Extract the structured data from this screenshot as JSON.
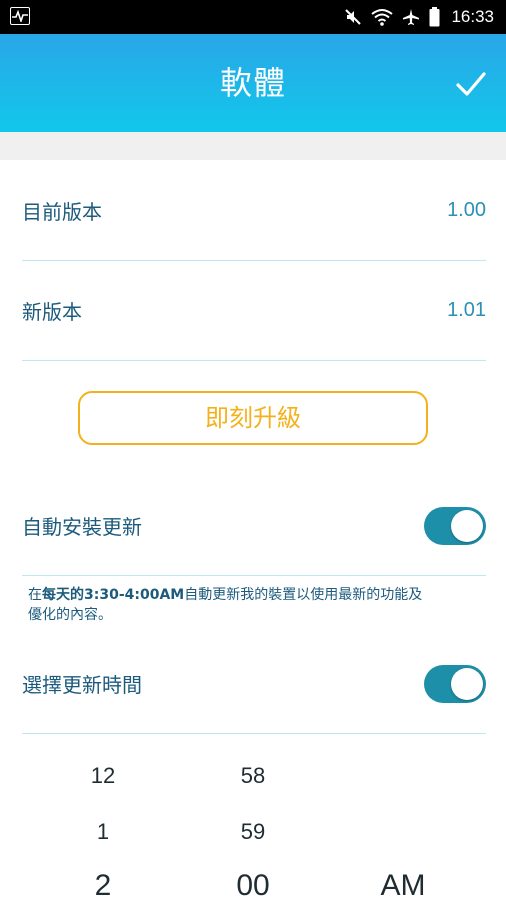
{
  "status_bar": {
    "time": "16:33",
    "icons": [
      "pulse-app-icon",
      "mute-icon",
      "wifi-icon",
      "airplane-icon",
      "battery-icon"
    ]
  },
  "header": {
    "title": "軟體",
    "confirm_icon": "check-icon"
  },
  "firmware": {
    "current_label": "目前版本",
    "current_value": "1.00",
    "new_label": "新版本",
    "new_value": "1.01",
    "upgrade_button": "即刻升級"
  },
  "auto_update": {
    "label": "自動安裝更新",
    "enabled": true,
    "desc_prefix": "在",
    "desc_bold": "每天的3:30-4:00AM",
    "desc_suffix": "自動更新我的裝置以使用最新的功能及優化的內容。"
  },
  "schedule": {
    "label": "選擇更新時間",
    "enabled": true
  },
  "time_picker": {
    "hour_above2": "12",
    "hour_above1": "1",
    "hour_selected": "2",
    "minute_above2": "58",
    "minute_above1": "59",
    "minute_selected": "00",
    "ampm_selected": "AM"
  },
  "colors": {
    "header_top": "#2aa6e8",
    "header_bottom": "#11c7ea",
    "accent_text": "#1c5b7c",
    "upgrade_border": "#f3b21c",
    "toggle_on": "#1e8fa8"
  }
}
